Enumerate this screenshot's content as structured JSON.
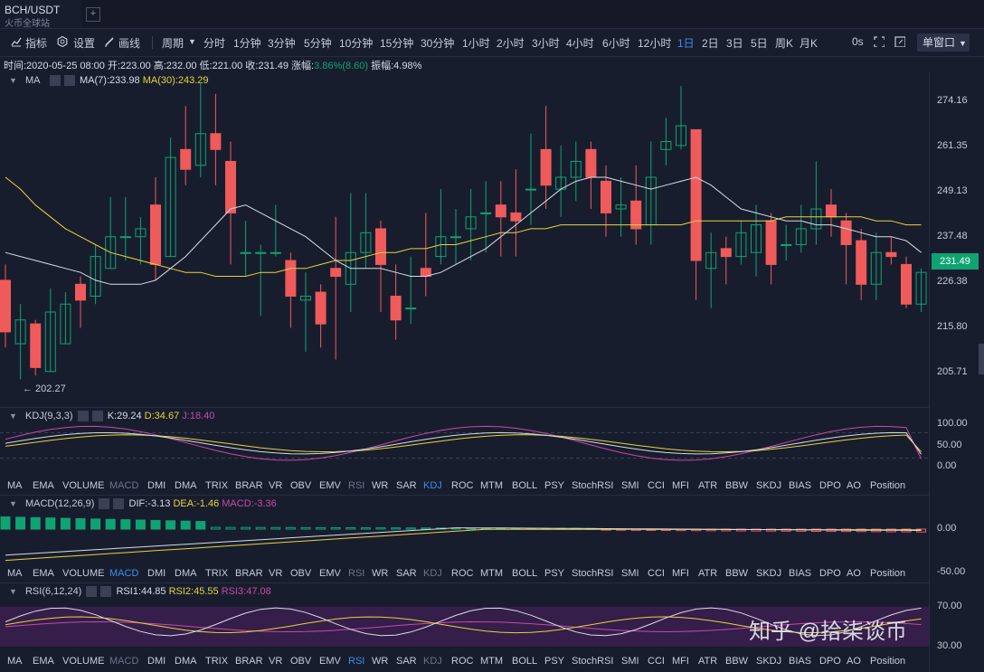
{
  "tab": {
    "pair": "BCH/USDT",
    "exchange": "火币全球站"
  },
  "toolbar": {
    "indicator": "指标",
    "settings": "设置",
    "draw": "画线",
    "period": "周期",
    "periods": [
      "分时",
      "1分钟",
      "3分钟",
      "5分钟",
      "10分钟",
      "15分钟",
      "30分钟",
      "1小时",
      "2小时",
      "3小时",
      "4小时",
      "6小时",
      "12小时",
      "1日",
      "2日",
      "3日",
      "5日",
      "周K",
      "月K"
    ],
    "active_period": "1日",
    "countdown": "0s",
    "window_mode": "单窗口"
  },
  "info": {
    "time": "时间:2020-05-25 08:00",
    "open": "开:223.00",
    "high": "高:232.00",
    "low": "低:221.00",
    "close": "收:231.49",
    "change_label": "涨幅:",
    "change": "3.86%(8.60)",
    "amplitude": "振幅:4.98%"
  },
  "ma_pane": {
    "name": "MA",
    "ma7": "MA(7):233.98",
    "ma30": "MA(30):243.29",
    "low_marker": "← 202.27",
    "last_price": "231.49",
    "ticks": [
      "274.16",
      "261.35",
      "249.13",
      "237.48",
      "226.38",
      "215.80",
      "205.71"
    ]
  },
  "kdj_pane": {
    "name": "KDJ(9,3,3)",
    "k": "K:29.24",
    "d": "D:34.67",
    "j": "J:18.40",
    "ticks": [
      "100.00",
      "50.00",
      "0.00"
    ]
  },
  "macd_pane": {
    "name": "MACD(12,26,9)",
    "dif": "DIF:-3.13",
    "dea": "DEA:-1.46",
    "macd": "MACD:-3.36",
    "ticks": [
      "0.00",
      "-50.00"
    ]
  },
  "rsi_pane": {
    "name": "RSI(6,12,24)",
    "rsi1": "RSI1:44.85",
    "rsi2": "RSI2:45.55",
    "rsi3": "RSI3:47.08",
    "ticks": [
      "70.00",
      "30.00"
    ]
  },
  "indicator_tabs": [
    "MA",
    "EMA",
    "VOLUME",
    "MACD",
    "DMI",
    "DMA",
    "TRIX",
    "BRAR",
    "VR",
    "OBV",
    "EMV",
    "RSI",
    "WR",
    "SAR",
    "KDJ",
    "ROC",
    "MTM",
    "BOLL",
    "PSY",
    "StochRSI",
    "SMI",
    "CCI",
    "MFI",
    "ATR",
    "BBW",
    "SKDJ",
    "BIAS",
    "DPO",
    "AO",
    "Position"
  ],
  "watermark": "知乎 @拾柒谈币",
  "colors": {
    "up": "#ef5b5b",
    "down": "#0ea472",
    "ma7": "#d8dbe6",
    "ma30": "#e8d33a",
    "k": "#d8dbe6",
    "d": "#e8d33a",
    "j": "#c64aa8",
    "active": "#3a8ee6"
  },
  "chart_data": {
    "type": "candlestick",
    "candles": [
      [
        229,
        216,
        233,
        212
      ],
      [
        213,
        219,
        223,
        204
      ],
      [
        218,
        207,
        219,
        205
      ],
      [
        206,
        221,
        227,
        206
      ],
      [
        213,
        223,
        226,
        213
      ],
      [
        228,
        224,
        230,
        217
      ],
      [
        225,
        235,
        238,
        223
      ],
      [
        232,
        240,
        250,
        232
      ],
      [
        240,
        240,
        250,
        234
      ],
      [
        240,
        242,
        245,
        233
      ],
      [
        248,
        233,
        255,
        229
      ],
      [
        235,
        260,
        265,
        235
      ],
      [
        262,
        257,
        273,
        253
      ],
      [
        258,
        266,
        279,
        255
      ],
      [
        266,
        262,
        276,
        253
      ],
      [
        259,
        246,
        264,
        233
      ],
      [
        236,
        236,
        244,
        230
      ],
      [
        236,
        236,
        238,
        220
      ],
      [
        236,
        236,
        248,
        235
      ],
      [
        234,
        225,
        236,
        217
      ],
      [
        224,
        225,
        231,
        211
      ],
      [
        226,
        218,
        228,
        212
      ],
      [
        232,
        230,
        245,
        209
      ],
      [
        228,
        236,
        251,
        221
      ],
      [
        236,
        241,
        251,
        232
      ],
      [
        242,
        233,
        244,
        221
      ],
      [
        225,
        219,
        233,
        214
      ],
      [
        222,
        222,
        235,
        218
      ],
      [
        232,
        230,
        246,
        225
      ],
      [
        235,
        240,
        252,
        233
      ],
      [
        240,
        240,
        247,
        233
      ],
      [
        242,
        245,
        252,
        234
      ],
      [
        246,
        246,
        254,
        236
      ],
      [
        248,
        245,
        254,
        235
      ],
      [
        246,
        244,
        257,
        235
      ],
      [
        252,
        252,
        266,
        243
      ],
      [
        262,
        253,
        273,
        247
      ],
      [
        252,
        255,
        263,
        245
      ],
      [
        255,
        259,
        264,
        249
      ],
      [
        262,
        255,
        264,
        247
      ],
      [
        254,
        246,
        258,
        240
      ],
      [
        247,
        248,
        255,
        240
      ],
      [
        249,
        242,
        258,
        238
      ],
      [
        243,
        255,
        264,
        238
      ],
      [
        262,
        264,
        270,
        258
      ],
      [
        263,
        268,
        278,
        262
      ],
      [
        267,
        234,
        267,
        224
      ],
      [
        232,
        236,
        241,
        222
      ],
      [
        237,
        235,
        240,
        228
      ],
      [
        235,
        241,
        244,
        233
      ],
      [
        236,
        243,
        248,
        230
      ],
      [
        244,
        233,
        246,
        228
      ],
      [
        238,
        238,
        243,
        234
      ],
      [
        238,
        242,
        248,
        236
      ],
      [
        242,
        247,
        259,
        238
      ],
      [
        248,
        245,
        252,
        240
      ],
      [
        244,
        238,
        246,
        228
      ],
      [
        239,
        228,
        242,
        224
      ],
      [
        228,
        236,
        241,
        224
      ],
      [
        236,
        235,
        240,
        233
      ],
      [
        233,
        223,
        235,
        222
      ],
      [
        223,
        231,
        232,
        221
      ]
    ],
    "ma7": [
      236,
      235,
      234,
      233,
      232,
      231,
      229,
      228,
      228,
      228,
      229,
      232,
      235,
      239,
      243,
      247,
      248,
      246,
      244,
      242,
      240,
      237,
      234,
      232,
      232,
      232,
      231,
      230,
      230,
      231,
      233,
      235,
      237,
      240,
      243,
      246,
      249,
      252,
      254,
      255,
      255,
      254,
      253,
      252,
      253,
      254,
      255,
      253,
      250,
      247,
      246,
      245,
      244,
      244,
      243,
      243,
      242,
      241,
      240,
      240,
      239,
      236
    ],
    "ma30": [
      255,
      252,
      248,
      245,
      242,
      240,
      238,
      236,
      235,
      234,
      233,
      232,
      231,
      231,
      230,
      230,
      230,
      231,
      231,
      232,
      232,
      233,
      234,
      234,
      235,
      236,
      236,
      237,
      237,
      238,
      238,
      239,
      240,
      241,
      241,
      242,
      242,
      243,
      243,
      243,
      243,
      243,
      243,
      243,
      243,
      243,
      244,
      244,
      244,
      244,
      244,
      244,
      245,
      245,
      245,
      245,
      245,
      245,
      244,
      244,
      243,
      243
    ]
  }
}
